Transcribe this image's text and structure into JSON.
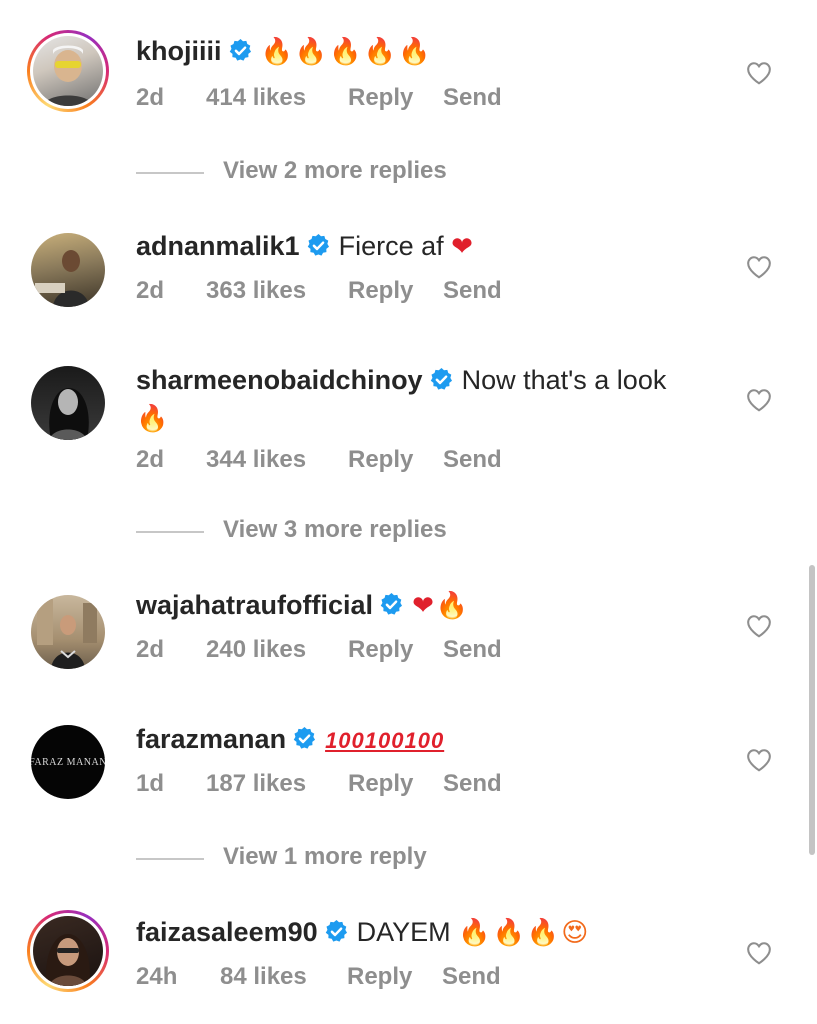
{
  "comments": [
    {
      "username": "khojiiii",
      "text": "",
      "emoji": "🔥🔥🔥🔥🔥",
      "time": "2d",
      "likes": "414 likes",
      "reply": "Reply",
      "send": "Send"
    },
    {
      "username": "adnanmalik1",
      "text": "Fierce af",
      "emoji": "❤",
      "time": "2d",
      "likes": "363 likes",
      "reply": "Reply",
      "send": "Send"
    },
    {
      "username": "sharmeenobaidchinoy",
      "text": "Now that's a look",
      "emoji": "🔥",
      "time": "2d",
      "likes": "344 likes",
      "reply": "Reply",
      "send": "Send"
    },
    {
      "username": "wajahatraufofficial",
      "text": "",
      "emoji": "❤🔥",
      "time": "2d",
      "likes": "240 likes",
      "reply": "Reply",
      "send": "Send"
    },
    {
      "username": "farazmanan",
      "text": "",
      "emoji": "100100100",
      "avatar_text": "FARAZ MANAN",
      "time": "1d",
      "likes": "187 likes",
      "reply": "Reply",
      "send": "Send"
    },
    {
      "username": "faizasaleem90",
      "text": "DAYEM",
      "emoji": "🔥🔥🔥😍",
      "time": "24h",
      "likes": "84 likes",
      "reply": "Reply",
      "send": "Send"
    }
  ],
  "view_replies": [
    "View 2 more replies",
    "View 3 more replies",
    "View 1 more reply"
  ],
  "colors": {
    "text": "#262626",
    "meta": "#8e8e8e",
    "verified": "#1d9bf0",
    "fire": "#f26a1b",
    "heart": "#e0202c"
  }
}
